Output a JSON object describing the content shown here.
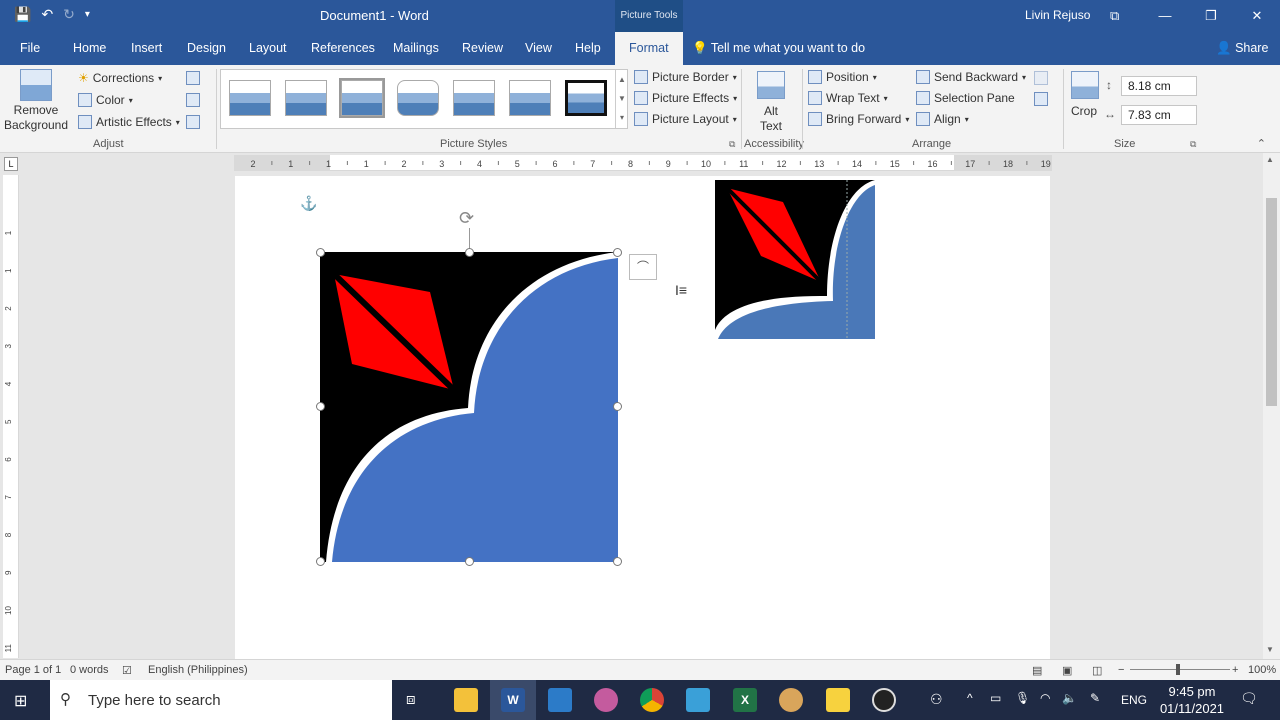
{
  "window": {
    "title": "Document1  -  Word",
    "tools_label": "Picture Tools",
    "user": "Livin Rejuso",
    "min_label": "—",
    "restore_label": "❐",
    "close_label": "✕"
  },
  "tabs": [
    {
      "label": "File"
    },
    {
      "label": "Home"
    },
    {
      "label": "Insert"
    },
    {
      "label": "Design"
    },
    {
      "label": "Layout"
    },
    {
      "label": "References"
    },
    {
      "label": "Mailings"
    },
    {
      "label": "Review"
    },
    {
      "label": "View"
    },
    {
      "label": "Help"
    },
    {
      "label": "Format",
      "active": true
    }
  ],
  "tell_me": "Tell me what you want to do",
  "share": "Share",
  "ribbon": {
    "adjust": {
      "remove_background": "Remove Background",
      "corrections": "Corrections",
      "color": "Color",
      "artistic_effects": "Artistic Effects",
      "label": "Adjust"
    },
    "picture_styles": {
      "label": "Picture Styles",
      "border": "Picture Border",
      "effects": "Picture Effects",
      "layout": "Picture Layout"
    },
    "accessibility": {
      "alt_text": "Alt Text",
      "label": "Accessibility"
    },
    "arrange": {
      "position": "Position",
      "wrap_text": "Wrap Text",
      "bring_forward": "Bring Forward",
      "send_backward": "Send Backward",
      "selection_pane": "Selection Pane",
      "align": "Align",
      "label": "Arrange"
    },
    "size": {
      "crop": "Crop",
      "height": "8.18 cm",
      "width": "7.83 cm",
      "label": "Size"
    }
  },
  "ruler": {
    "marks": [
      "2",
      "1",
      "1",
      "1",
      "2",
      "3",
      "4",
      "5",
      "6",
      "7",
      "8",
      "9",
      "10",
      "11",
      "12",
      "13",
      "14",
      "15",
      "16",
      "17",
      "18",
      "19"
    ],
    "vmarks": [
      "1",
      "1",
      "2",
      "3",
      "4",
      "5",
      "6",
      "7",
      "8",
      "9",
      "10",
      "11",
      "12"
    ]
  },
  "status": {
    "page": "Page 1 of 1",
    "words": "0 words",
    "language": "English (Philippines)",
    "zoom": "100%"
  },
  "taskbar": {
    "search_placeholder": "Type here to search",
    "lang": "ENG",
    "time": "9:45 pm",
    "date": "01/11/2021"
  },
  "colors": {
    "word_blue": "#2b579a",
    "shape_blue": "#4472c4",
    "shape_red": "#ff0000",
    "shape_black": "#000000"
  }
}
